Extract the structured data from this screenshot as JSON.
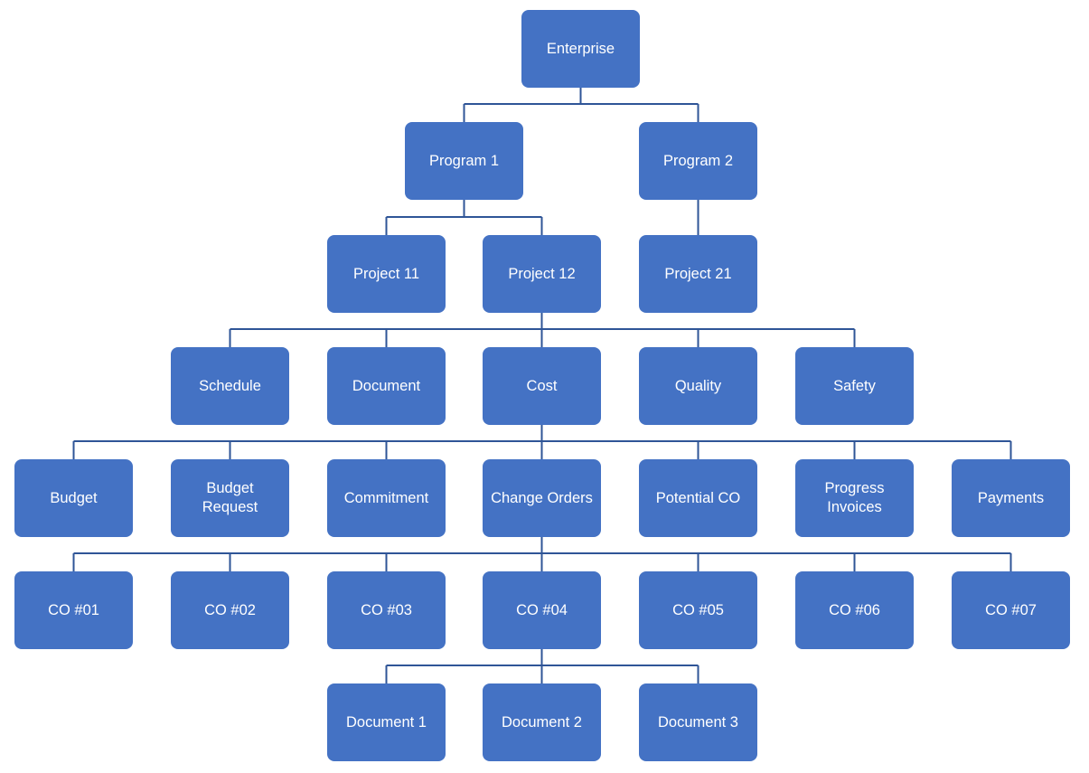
{
  "diagram": {
    "title": "",
    "colors": {
      "node_fill": "#4472C4",
      "connector": "#2F5597",
      "text": "#FFFFFF"
    },
    "nodes": [
      {
        "id": "enterprise",
        "label": "Enterprise",
        "parent": null,
        "level": 0
      },
      {
        "id": "program-1",
        "label": "Program 1",
        "parent": "enterprise",
        "level": 1
      },
      {
        "id": "program-2",
        "label": "Program 2",
        "parent": "enterprise",
        "level": 1
      },
      {
        "id": "project-11",
        "label": "Project 11",
        "parent": "program-1",
        "level": 2
      },
      {
        "id": "project-12",
        "label": "Project 12",
        "parent": "program-1",
        "level": 2
      },
      {
        "id": "project-21",
        "label": "Project 21",
        "parent": "program-2",
        "level": 2
      },
      {
        "id": "schedule",
        "label": "Schedule",
        "parent": "project-12",
        "level": 3
      },
      {
        "id": "document",
        "label": "Document",
        "parent": "project-12",
        "level": 3
      },
      {
        "id": "cost",
        "label": "Cost",
        "parent": "project-12",
        "level": 3
      },
      {
        "id": "quality",
        "label": "Quality",
        "parent": "project-12",
        "level": 3
      },
      {
        "id": "safety",
        "label": "Safety",
        "parent": "project-12",
        "level": 3
      },
      {
        "id": "budget",
        "label": "Budget",
        "parent": "cost",
        "level": 4
      },
      {
        "id": "budget-request",
        "label": "Budget\nRequest",
        "parent": "cost",
        "level": 4
      },
      {
        "id": "commitment",
        "label": "Commitment",
        "parent": "cost",
        "level": 4
      },
      {
        "id": "change-orders",
        "label": "Change Orders",
        "parent": "cost",
        "level": 4
      },
      {
        "id": "potential-co",
        "label": "Potential CO",
        "parent": "cost",
        "level": 4
      },
      {
        "id": "progress-invoices",
        "label": "Progress\nInvoices",
        "parent": "cost",
        "level": 4
      },
      {
        "id": "payments",
        "label": "Payments",
        "parent": "cost",
        "level": 4
      },
      {
        "id": "co-01",
        "label": "CO #01",
        "parent": "change-orders",
        "level": 5
      },
      {
        "id": "co-02",
        "label": "CO #02",
        "parent": "change-orders",
        "level": 5
      },
      {
        "id": "co-03",
        "label": "CO #03",
        "parent": "change-orders",
        "level": 5
      },
      {
        "id": "co-04",
        "label": "CO #04",
        "parent": "change-orders",
        "level": 5
      },
      {
        "id": "co-05",
        "label": "CO #05",
        "parent": "change-orders",
        "level": 5
      },
      {
        "id": "co-06",
        "label": "CO #06",
        "parent": "change-orders",
        "level": 5
      },
      {
        "id": "co-07",
        "label": "CO #07",
        "parent": "change-orders",
        "level": 5
      },
      {
        "id": "document-1",
        "label": "Document 1",
        "parent": "co-04",
        "level": 6
      },
      {
        "id": "document-2",
        "label": "Document 2",
        "parent": "co-04",
        "level": 6
      },
      {
        "id": "document-3",
        "label": "Document 3",
        "parent": "co-04",
        "level": 6
      }
    ]
  }
}
